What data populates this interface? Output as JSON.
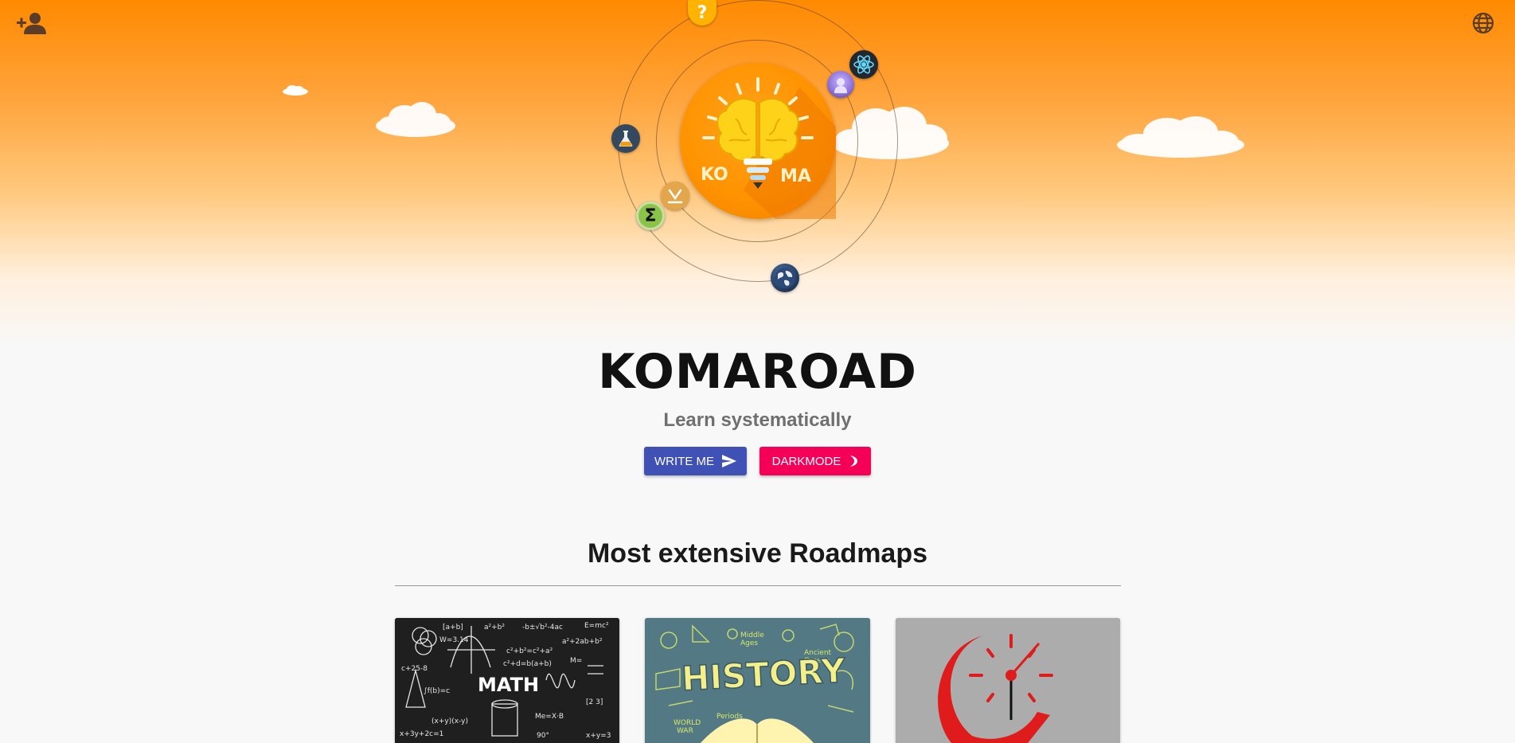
{
  "header": {
    "add_user_icon": "add-user-icon",
    "language_icon": "globe-icon"
  },
  "logo": {
    "left_text": "KO",
    "right_text": "MA",
    "planets": [
      "question-icon",
      "react-icon",
      "avatar",
      "flask-icon",
      "magnet-icon",
      "sigma-icon",
      "earth-icon"
    ],
    "question_glyph": "?",
    "sigma_glyph": "Σ"
  },
  "hero": {
    "title": "KOMAROAD",
    "subtitle": "Learn systematically",
    "write_me_label": "WRITE ME",
    "darkmode_label": "DARKMODE"
  },
  "roadmaps": {
    "section_title": "Most extensive Roadmaps",
    "cards": [
      {
        "image_text": "MATH",
        "theme": "chalkboard"
      },
      {
        "image_text": "HISTORY",
        "theme": "teal"
      },
      {
        "image_text": "",
        "theme": "clock"
      }
    ]
  },
  "colors": {
    "primary": "#3f51b5",
    "accent": "#f50057",
    "orange": "#ff8a00"
  }
}
